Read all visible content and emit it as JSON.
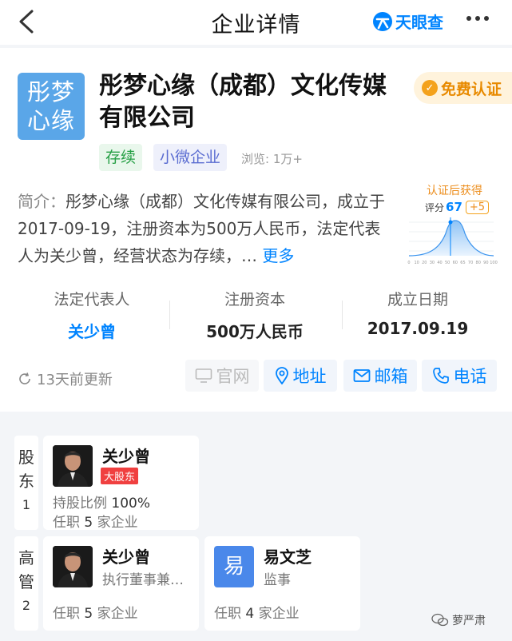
{
  "header": {
    "title": "企业详情",
    "brand": "天眼查"
  },
  "company": {
    "logo_text_line1": "彤梦",
    "logo_text_line2": "心缘",
    "name": "彤梦心缘（成都）文化传媒有限公司",
    "cert_label": "免费认证",
    "tags": [
      "存续",
      "小微企业"
    ],
    "views": "浏览: 1万+",
    "intro_label": "简介：",
    "intro_text": "彤梦心缘（成都）文化传媒有限公司，成立于2017-09-19，注册资本为500万人民币，法定代表人为关少曾，经营状态为存续，…",
    "intro_more": "更多"
  },
  "score": {
    "headline": "认证后获得",
    "label": "评分",
    "value": "67",
    "bonus": "+5",
    "axis_ticks": [
      "0",
      "10",
      "20",
      "30",
      "40",
      "50",
      "60",
      "65",
      "70",
      "80",
      "90",
      "100"
    ]
  },
  "stats": [
    {
      "label": "法定代表人",
      "value": "关少曾"
    },
    {
      "label": "注册资本",
      "value": "500万人民币"
    },
    {
      "label": "成立日期",
      "value": "2017.09.19"
    }
  ],
  "update_text": "13天前更新",
  "actions": {
    "website": "官网",
    "address": "地址",
    "email": "邮箱",
    "phone": "电话"
  },
  "shareholders": {
    "side_label_1": "股",
    "side_label_2": "东",
    "count": "1",
    "person": {
      "name": "关少曾",
      "badge": "大股东",
      "ratio_label": "持股比例",
      "ratio": "100%",
      "jobs_prefix": "任职",
      "jobs_count": "5",
      "jobs_suffix": "家企业"
    }
  },
  "executives": {
    "side_label_1": "高",
    "side_label_2": "管",
    "count": "2",
    "people": [
      {
        "name": "关少曾",
        "role": "执行董事兼…",
        "jobs_prefix": "任职",
        "jobs_count": "5",
        "jobs_suffix": "家企业"
      },
      {
        "name": "易文芝",
        "avatar_letter": "易",
        "role": "监事",
        "jobs_prefix": "任职",
        "jobs_count": "4",
        "jobs_suffix": "家企业"
      }
    ]
  },
  "watermark": "萝严肃",
  "colors": {
    "accent": "#0084ff",
    "cert": "#e88a00",
    "tag_green": "#27a046",
    "tag_blue": "#5a6cd1",
    "badge_red": "#f04040"
  }
}
